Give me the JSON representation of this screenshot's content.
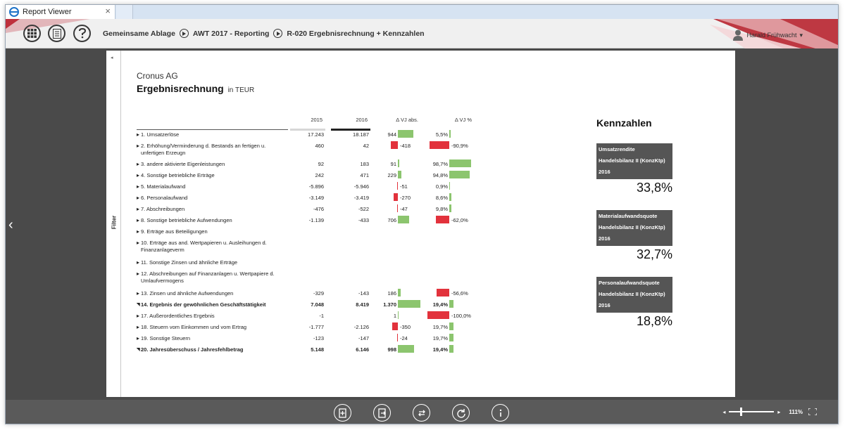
{
  "window": {
    "tab_title": "Report Viewer",
    "tab_close": "×"
  },
  "header": {
    "icons": [
      "grid-icon",
      "list-icon",
      "help-icon"
    ],
    "breadcrumb": [
      "Gemeinsame Ablage",
      "AWT 2017 - Reporting",
      "R-020 Ergebnisrechnung + Kennzahlen"
    ],
    "user": "Harald Frühwacht",
    "user_caret": "▾"
  },
  "sidebar": {
    "filter_label": "Filter",
    "collapse_arrow": "◂",
    "nav_back": "‹"
  },
  "report": {
    "company": "Cronus AG",
    "title": "Ergebnisrechnung",
    "unit": "in  TEUR",
    "columns": [
      "2015",
      "2016",
      "Δ VJ abs.",
      "Δ VJ %"
    ],
    "rows": [
      {
        "label": "1. Umsatzerlöse",
        "v2015": "17.243",
        "v2016": "18.187",
        "abs": "944",
        "abs_value": 944,
        "pct": "5,5%",
        "pct_value": 5.5
      },
      {
        "label": "2. Erhöhung/Verminderung d. Bestands an fertigen u. unfertigen Erzeugn",
        "v2015": "460",
        "v2016": "42",
        "abs": "-418",
        "abs_value": -418,
        "pct": "-90,9%",
        "pct_value": -90.9
      },
      {
        "label": "3. andere aktivierte Eigenleistungen",
        "v2015": "92",
        "v2016": "183",
        "abs": "91",
        "abs_value": 91,
        "pct": "98,7%",
        "pct_value": 98.7
      },
      {
        "label": "4. Sonstige betriebliche Erträge",
        "v2015": "242",
        "v2016": "471",
        "abs": "229",
        "abs_value": 229,
        "pct": "94,8%",
        "pct_value": 94.8
      },
      {
        "label": "5. Materialaufwand",
        "v2015": "-5.896",
        "v2016": "-5.946",
        "abs": "-51",
        "abs_value": -51,
        "pct": "0,9%",
        "pct_value": 0.9
      },
      {
        "label": "6. Personalaufwand",
        "v2015": "-3.149",
        "v2016": "-3.419",
        "abs": "-270",
        "abs_value": -270,
        "pct": "8,6%",
        "pct_value": 8.6
      },
      {
        "label": "7. Abschreibungen",
        "v2015": "-476",
        "v2016": "-522",
        "abs": "-47",
        "abs_value": -47,
        "pct": "9,8%",
        "pct_value": 9.8
      },
      {
        "label": "8. Sonstige betriebliche Aufwendungen",
        "v2015": "-1.139",
        "v2016": "-433",
        "abs": "706",
        "abs_value": 706,
        "pct": "-62,0%",
        "pct_value": -62.0
      },
      {
        "label": "9. Erträge aus Beteiligungen",
        "v2015": "",
        "v2016": "",
        "abs": "",
        "abs_value": null,
        "pct": "",
        "pct_value": null
      },
      {
        "label": "10. Erträge aus and. Wertpapieren u. Ausleihungen d. Finanzanlageverm",
        "v2015": "",
        "v2016": "",
        "abs": "",
        "abs_value": null,
        "pct": "",
        "pct_value": null
      },
      {
        "label": "11. Sonstige Zinsen und ähnliche Erträge",
        "v2015": "",
        "v2016": "",
        "abs": "",
        "abs_value": null,
        "pct": "",
        "pct_value": null
      },
      {
        "label": "12. Abschreibungen auf Finanzanlagen u. Wertpapiere d. Umlaufvermogens",
        "v2015": "",
        "v2016": "",
        "abs": "",
        "abs_value": null,
        "pct": "",
        "pct_value": null
      },
      {
        "label": "13. Zinsen und ähnliche Aufwendungen",
        "v2015": "-329",
        "v2016": "-143",
        "abs": "186",
        "abs_value": 186,
        "pct": "-56,6%",
        "pct_value": -56.6
      },
      {
        "label": "14. Ergebnis der gewöhnlichen Geschäftstätigkeit",
        "v2015": "7.048",
        "v2016": "8.419",
        "abs": "1.370",
        "abs_value": 1370,
        "pct": "19,4%",
        "pct_value": 19.4,
        "bold": true
      },
      {
        "label": "17. Außerordentliches Ergebnis",
        "v2015": "-1",
        "v2016": "",
        "abs": "1",
        "abs_value": 1,
        "pct": "-100,0%",
        "pct_value": -100.0
      },
      {
        "label": "18. Steuern vom Einkommen und vom Ertrag",
        "v2015": "-1.777",
        "v2016": "-2.126",
        "abs": "-350",
        "abs_value": -350,
        "pct": "19,7%",
        "pct_value": 19.7
      },
      {
        "label": "19. Sonstige Steuern",
        "v2015": "-123",
        "v2016": "-147",
        "abs": "-24",
        "abs_value": -24,
        "pct": "19,7%",
        "pct_value": 19.7
      },
      {
        "label": "20. Jahresüberschuss / Jahresfehlbetrag",
        "v2015": "5.148",
        "v2016": "6.146",
        "abs": "998",
        "abs_value": 998,
        "pct": "19,4%",
        "pct_value": 19.4,
        "bold": true
      }
    ]
  },
  "kennzahlen": {
    "title": "Kennzahlen",
    "cards": [
      {
        "name": "Umsatzrendite",
        "basis": "Handelsbilanz II (KonzKtp)",
        "year": "2016",
        "value": "33,8%"
      },
      {
        "name": "Materialaufwandsquote",
        "basis": "Handelsbilanz II (KonzKtp)",
        "year": "2016",
        "value": "32,7%"
      },
      {
        "name": "Personalaufwandsquote",
        "basis": "Handelsbilanz II (KonzKtp)",
        "year": "2016",
        "value": "18,8%"
      }
    ]
  },
  "footer": {
    "buttons": [
      "add-page-icon",
      "export-icon",
      "swap-icon",
      "refresh-icon",
      "info-icon"
    ],
    "zoom": "111%",
    "zoom_level": 0.3
  },
  "colors": {
    "positive": "#8cc56e",
    "negative": "#e2323c",
    "brand_red": "#b8232f",
    "dark": "#4a4a4a"
  }
}
